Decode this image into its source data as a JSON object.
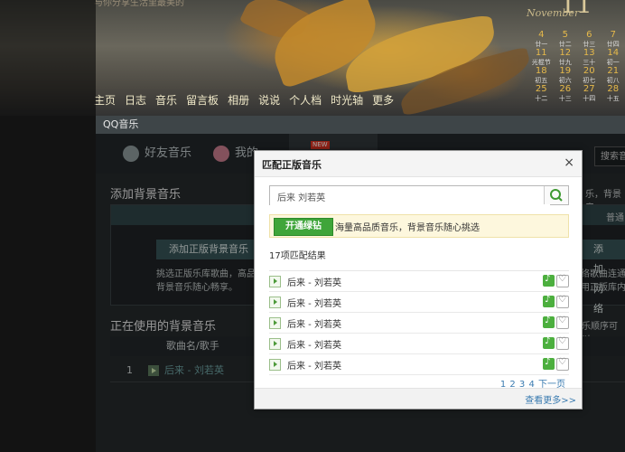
{
  "banner": {
    "top_text": "与你分享生活里最美的",
    "nav": [
      "主页",
      "日志",
      "音乐",
      "留言板",
      "相册",
      "说说",
      "个人档",
      "时光轴",
      "更多"
    ],
    "calendar": {
      "month_en": "November",
      "month_num": "11",
      "rows": [
        {
          "nums": [
            "4",
            "5",
            "6",
            "7"
          ],
          "lunar": [
            "廿一",
            "廿二",
            "廿三",
            "廿四"
          ]
        },
        {
          "nums": [
            "11",
            "12",
            "13",
            "14"
          ],
          "lunar": [
            "光棍节",
            "廿九",
            "三十",
            "初一"
          ]
        },
        {
          "nums": [
            "18",
            "19",
            "20",
            "21"
          ],
          "lunar": [
            "初五",
            "初六",
            "初七",
            "初八"
          ]
        },
        {
          "nums": [
            "25",
            "26",
            "27",
            "28"
          ],
          "lunar": [
            "十二",
            "十三",
            "十四",
            "十五"
          ]
        }
      ]
    }
  },
  "app": {
    "title": "QQ音乐",
    "tabs": [
      {
        "label": "好友音乐"
      },
      {
        "label": "我的"
      },
      {
        "label": ""
      },
      {
        "label": ""
      }
    ],
    "new_badge": "NEW",
    "search_label": "搜索音",
    "add_bg_title": "添加背景音乐",
    "right_cut_1": "乐，背景音",
    "right_cut_2": "普通",
    "add_licensed_btn": "添加正版背景音乐",
    "add_web_btn": "添加网络",
    "desc_1": "挑选正版乐库歌曲，高品质",
    "desc_2": "背景音乐随心畅享。",
    "desc_right_1": "络歌曲连通",
    "desc_right_2": "用正版库内",
    "in_use_title": "正在使用的背景音乐",
    "in_use_right": "乐顺序可以",
    "col_song": "歌曲名/歌手",
    "row_index": "1",
    "row_song": "后来 - 刘若英"
  },
  "modal": {
    "title": "匹配正版音乐",
    "close": "×",
    "search_value": "后来 刘若英",
    "vip_button": "开通绿钻",
    "vip_text": "海量高品质音乐，背景音乐随心挑选",
    "result_count": "17项匹配结果",
    "results": [
      {
        "name": "后来 - 刘若英"
      },
      {
        "name": "后来 - 刘若英"
      },
      {
        "name": "后来 - 刘若英"
      },
      {
        "name": "后来 - 刘若英"
      },
      {
        "name": "后来 - 刘若英"
      }
    ],
    "pager": "1 2 3 4 下一页",
    "more": "查看更多>>"
  },
  "colors": {
    "vip_green": "#3fa53a",
    "link_blue": "#3a7bb0",
    "app_bg": "#262a2c"
  }
}
